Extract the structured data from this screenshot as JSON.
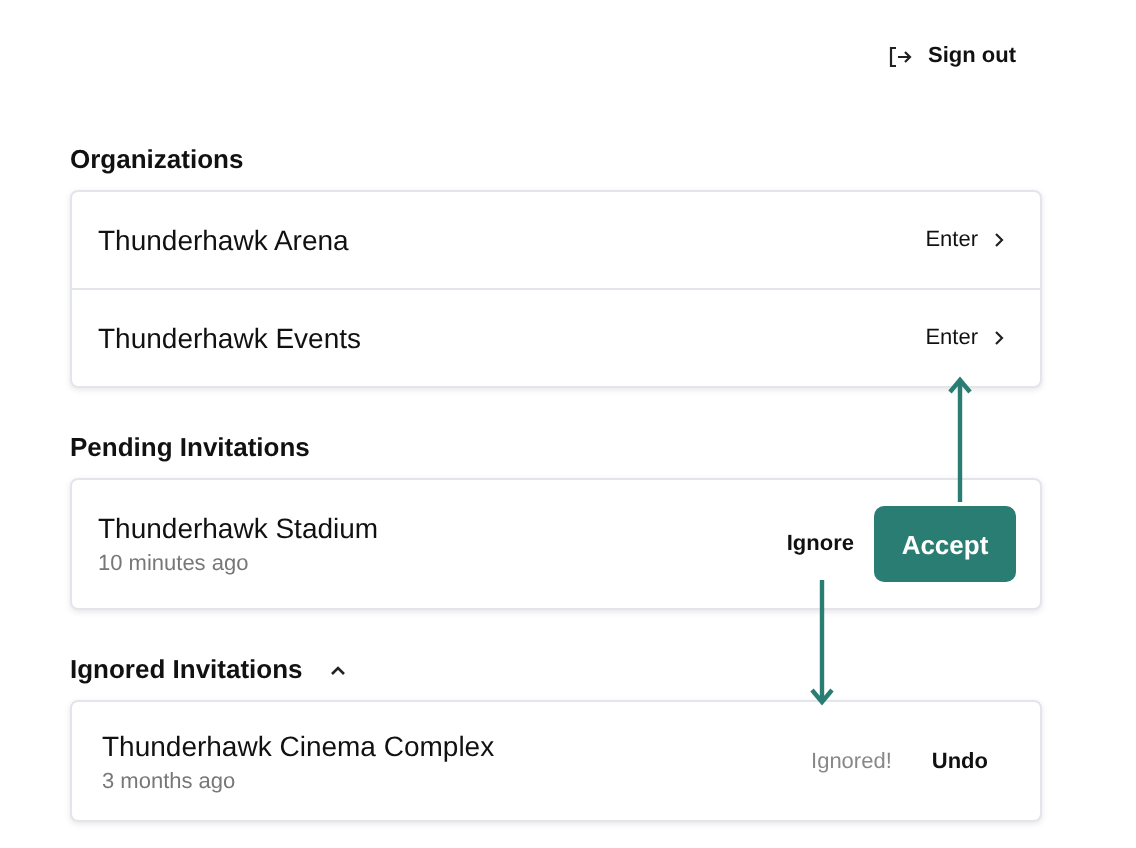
{
  "header": {
    "sign_out": "Sign out"
  },
  "organizations": {
    "title": "Organizations",
    "items": [
      {
        "name": "Thunderhawk Arena",
        "action": "Enter"
      },
      {
        "name": "Thunderhawk Events",
        "action": "Enter"
      }
    ]
  },
  "pending_invitations": {
    "title": "Pending Invitations",
    "items": [
      {
        "name": "Thunderhawk Stadium",
        "time": "10 minutes ago",
        "ignore": "Ignore",
        "accept": "Accept"
      }
    ]
  },
  "ignored_invitations": {
    "title": "Ignored Invitations",
    "expanded": true,
    "items": [
      {
        "name": "Thunderhawk Cinema Complex",
        "time": "3 months ago",
        "status": "Ignored!",
        "undo": "Undo"
      }
    ]
  }
}
